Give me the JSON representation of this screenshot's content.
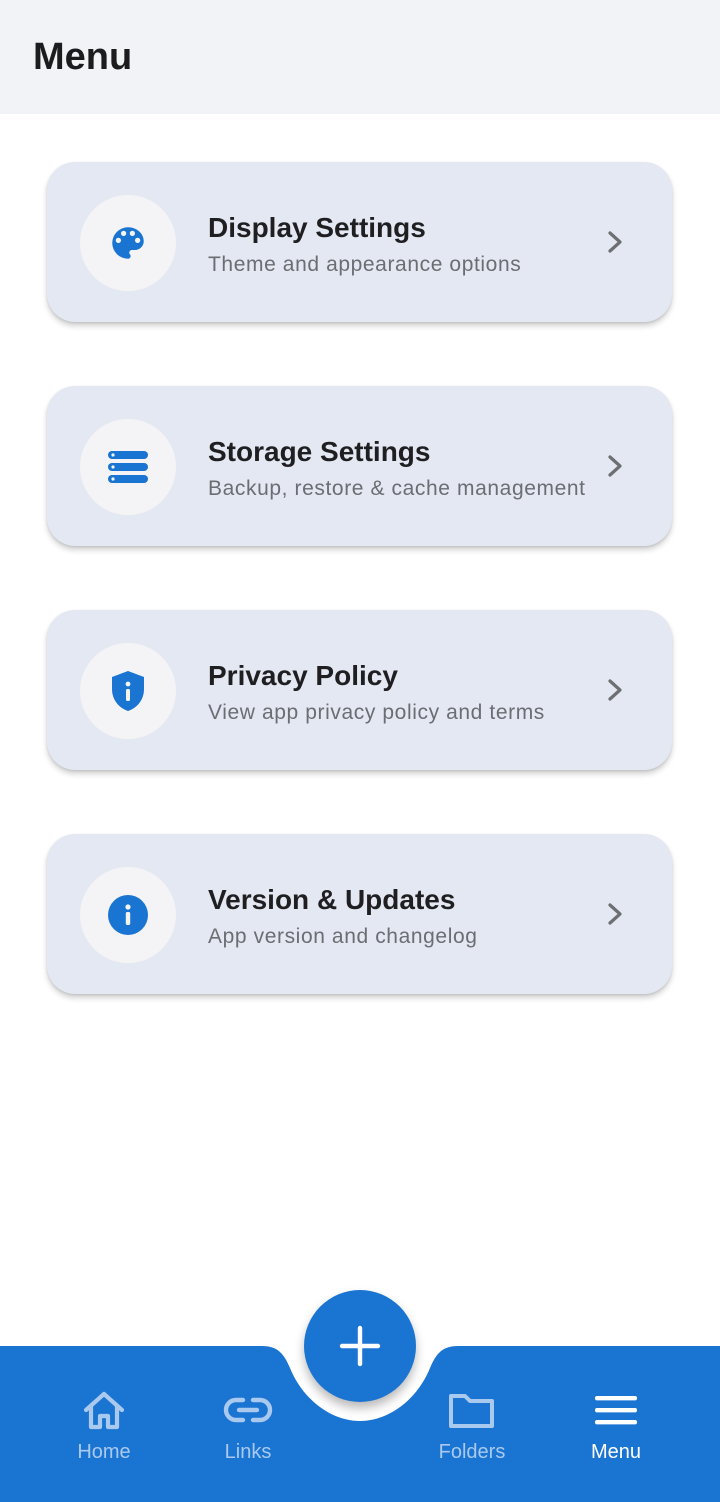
{
  "header": {
    "title": "Menu"
  },
  "menu_items": [
    {
      "title": "Display Settings",
      "subtitle": "Theme and appearance options",
      "icon": "palette-icon"
    },
    {
      "title": "Storage Settings",
      "subtitle": "Backup, restore & cache management",
      "icon": "storage-icon"
    },
    {
      "title": "Privacy Policy",
      "subtitle": "View app privacy policy and terms",
      "icon": "privacy-shield-icon"
    },
    {
      "title": "Version & Updates",
      "subtitle": "App version and changelog",
      "icon": "info-icon"
    }
  ],
  "bottom_nav": {
    "items": [
      {
        "label": "Home",
        "icon": "home-icon"
      },
      {
        "label": "Links",
        "icon": "link-icon"
      },
      {
        "label": "Folders",
        "icon": "folder-icon"
      },
      {
        "label": "Menu",
        "icon": "menu-icon",
        "active": true
      }
    ],
    "fab_icon": "plus-icon"
  },
  "colors": {
    "primary": "#1a74d2",
    "card_background": "#e4e8f2",
    "header_background": "#f2f3f7",
    "nav_inactive_label": "#a9c9ef",
    "nav_active_label": "#ffffff"
  }
}
